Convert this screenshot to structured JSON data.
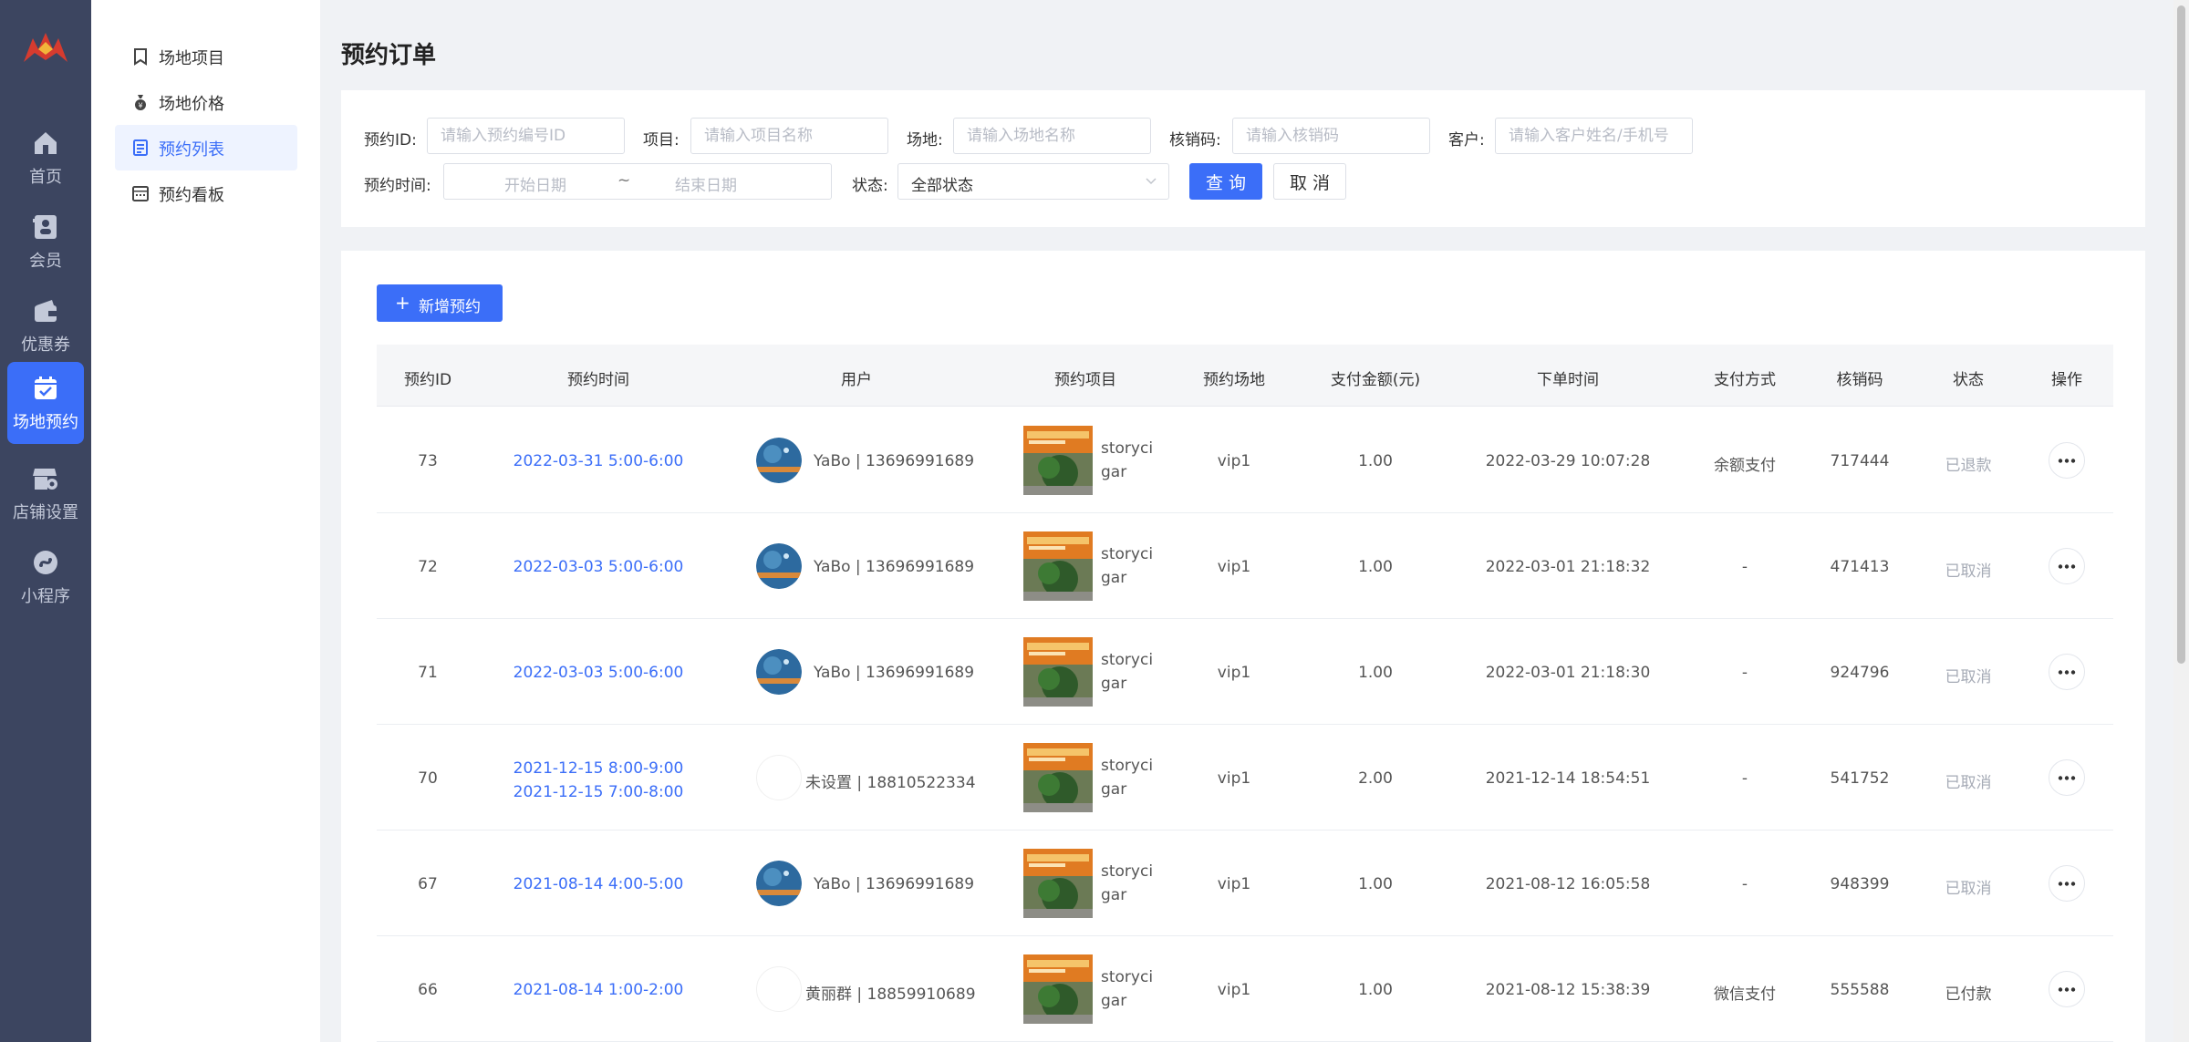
{
  "rail": {
    "items": [
      {
        "label": "首页",
        "icon": "home-icon"
      },
      {
        "label": "会员",
        "icon": "member-card-icon"
      },
      {
        "label": "优惠券",
        "icon": "wallet-icon"
      },
      {
        "label": "场地预约",
        "icon": "calendar-check-icon",
        "active": true
      },
      {
        "label": "店铺设置",
        "icon": "store-settings-icon"
      },
      {
        "label": "小程序",
        "icon": "mini-program-icon"
      }
    ]
  },
  "submenu": {
    "items": [
      {
        "label": "场地项目",
        "icon": "bookmark-icon"
      },
      {
        "label": "场地价格",
        "icon": "money-bag-icon"
      },
      {
        "label": "预约列表",
        "icon": "list-icon",
        "active": true
      },
      {
        "label": "预约看板",
        "icon": "board-icon"
      }
    ]
  },
  "page": {
    "title": "预约订单"
  },
  "filters": {
    "booking_id_label": "预约ID:",
    "booking_id_placeholder": "请输入预约编号ID",
    "project_label": "项目:",
    "project_placeholder": "请输入项目名称",
    "venue_label": "场地:",
    "venue_placeholder": "请输入场地名称",
    "code_label": "核销码:",
    "code_placeholder": "请输入核销码",
    "customer_label": "客户:",
    "customer_placeholder": "请输入客户姓名/手机号",
    "time_label": "预约时间:",
    "start_placeholder": "开始日期",
    "range_sep": "~",
    "end_placeholder": "结束日期",
    "status_label": "状态:",
    "status_value": "全部状态",
    "query_button": "查 询",
    "cancel_button": "取 消"
  },
  "toolbar": {
    "add_button": "新增预约"
  },
  "table": {
    "columns": [
      "预约ID",
      "预约时间",
      "用户",
      "预约项目",
      "预约场地",
      "支付金额(元)",
      "下单时间",
      "支付方式",
      "核销码",
      "状态",
      "操作"
    ],
    "rows": [
      {
        "id": "73",
        "time1": "2022-03-31 5:00-6:00",
        "time2": "",
        "user": "YaBo | 13696991689",
        "avatar": "photo",
        "project": "storyci\ngar",
        "venue": "vip1",
        "amount": "1.00",
        "order_time": "2022-03-29 10:07:28",
        "pay": "余额支付",
        "code": "717444",
        "status": "已退款",
        "status_type": "muted"
      },
      {
        "id": "72",
        "time1": "2022-03-03 5:00-6:00",
        "time2": "",
        "user": "YaBo | 13696991689",
        "avatar": "photo",
        "project": "storyci\ngar",
        "venue": "vip1",
        "amount": "1.00",
        "order_time": "2022-03-01 21:18:32",
        "pay": "-",
        "code": "471413",
        "status": "已取消",
        "status_type": "muted"
      },
      {
        "id": "71",
        "time1": "2022-03-03 5:00-6:00",
        "time2": "",
        "user": "YaBo | 13696991689",
        "avatar": "photo",
        "project": "storyci\ngar",
        "venue": "vip1",
        "amount": "1.00",
        "order_time": "2022-03-01 21:18:30",
        "pay": "-",
        "code": "924796",
        "status": "已取消",
        "status_type": "muted"
      },
      {
        "id": "70",
        "time1": "2021-12-15 8:00-9:00",
        "time2": "2021-12-15 7:00-8:00",
        "user": "未设置 | 18810522334",
        "avatar": "blank",
        "project": "storyci\ngar",
        "venue": "vip1",
        "amount": "2.00",
        "order_time": "2021-12-14 18:54:51",
        "pay": "-",
        "code": "541752",
        "status": "已取消",
        "status_type": "muted"
      },
      {
        "id": "67",
        "time1": "2021-08-14 4:00-5:00",
        "time2": "",
        "user": "YaBo | 13696991689",
        "avatar": "photo",
        "project": "storyci\ngar",
        "venue": "vip1",
        "amount": "1.00",
        "order_time": "2021-08-12 16:05:58",
        "pay": "-",
        "code": "948399",
        "status": "已取消",
        "status_type": "muted"
      },
      {
        "id": "66",
        "time1": "2021-08-14 1:00-2:00",
        "time2": "",
        "user": "黄丽群 | 18859910689",
        "avatar": "blank",
        "project": "storyci\ngar",
        "venue": "vip1",
        "amount": "1.00",
        "order_time": "2021-08-12 15:38:39",
        "pay": "微信支付",
        "code": "555588",
        "status": "已付款",
        "status_type": "ok"
      }
    ]
  },
  "colors": {
    "primary": "#3b6ef8",
    "rail_bg": "#3c4560",
    "muted_status": "#a6abb6"
  }
}
